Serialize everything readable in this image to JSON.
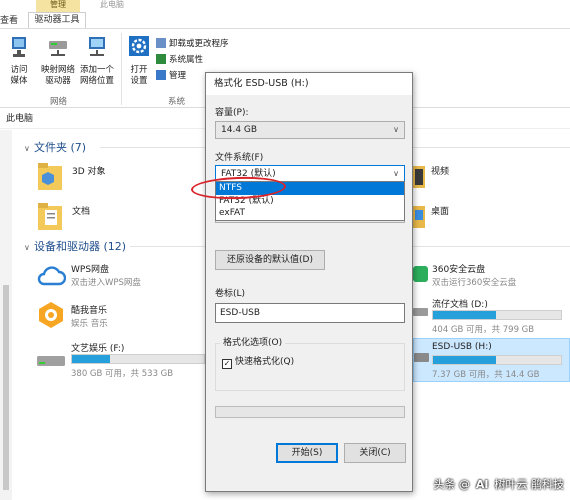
{
  "ribbon": {
    "tabs": {
      "manage": "管理",
      "contextual": "此电脑",
      "view": "查看",
      "drive_tools": "驱动器工具"
    },
    "network_group": {
      "label": "网络",
      "buttons": [
        {
          "label": "访问媒体",
          "icon": "media-icon"
        },
        {
          "label": "映射网络驱动器",
          "icon": "network-drive-icon"
        },
        {
          "label": "添加一个网络位置",
          "icon": "network-location-icon"
        }
      ]
    },
    "system_group": {
      "label": "系统",
      "open_settings": "打开设置",
      "items": [
        "卸载或更改程序",
        "系统属性",
        "管理"
      ]
    }
  },
  "address": "此电脑",
  "folders": {
    "header": "文件夹 (7)",
    "items": [
      {
        "name": "3D 对象",
        "icon": "3d-objects-icon"
      },
      {
        "name": "视频",
        "icon": "video-folder-icon"
      },
      {
        "name": "文档",
        "icon": "documents-folder-icon"
      },
      {
        "name": "桌面",
        "icon": "desktop-folder-icon"
      }
    ]
  },
  "devices": {
    "header": "设备和驱动器 (12)",
    "items": [
      {
        "name": "WPS网盘",
        "sub": "双击进入WPS网盘",
        "icon": "wps-cloud-icon"
      },
      {
        "name": "360安全云盘",
        "sub": "双击运行360安全云盘",
        "icon": "360-cloud-icon"
      },
      {
        "name": "酷我音乐",
        "sub": "娱乐 音乐",
        "icon": "kuwo-music-icon"
      },
      {
        "name": "流仔文档 (D:)",
        "sub": "404 GB 可用，共 799 GB",
        "used": 0.49,
        "icon": "drive-icon"
      },
      {
        "name": "文艺娱乐 (F:)",
        "sub": "380 GB 可用，共 533 GB",
        "used": 0.29,
        "icon": "drive-icon"
      },
      {
        "name": "ESD-USB (H:)",
        "sub": "7.37 GB 可用，共 14.4 GB",
        "used": 0.49,
        "icon": "usb-drive-icon"
      }
    ]
  },
  "dialog": {
    "title": "格式化 ESD-USB (H:)",
    "capacity_label": "容量(P):",
    "capacity_value": "14.4 GB",
    "fs_label": "文件系统(F)",
    "fs_value": "FAT32 (默认)",
    "fs_options": [
      "NTFS",
      "FAT32 (默认)",
      "exFAT"
    ],
    "fs_selected_index": 0,
    "restore_defaults": "还原设备的默认值(D)",
    "volume_label": "卷标(L)",
    "volume_value": "ESD-USB",
    "format_options_label": "格式化选项(O)",
    "quick_format": "快速格式化(Q)",
    "quick_format_checked": true,
    "start": "开始(S)",
    "close": "关闭(C)"
  },
  "watermark": {
    "prefix": "头条 @",
    "logo": "AI",
    "brand": "树叶云",
    "suffix": "鹃科技"
  },
  "colors": {
    "accent": "#0078d7",
    "drive_fill": "#26a0da",
    "annotation": "#d9242b"
  }
}
